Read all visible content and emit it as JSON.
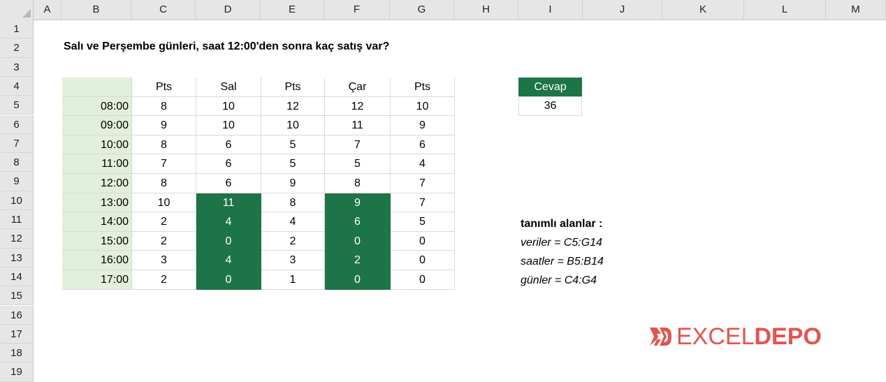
{
  "columns": [
    "A",
    "B",
    "C",
    "D",
    "E",
    "F",
    "G",
    "H",
    "I",
    "J",
    "K",
    "L",
    "M"
  ],
  "rows": [
    "1",
    "2",
    "3",
    "4",
    "5",
    "6",
    "7",
    "8",
    "9",
    "10",
    "11",
    "12",
    "13",
    "14",
    "15",
    "16",
    "17",
    "18",
    "19"
  ],
  "title": "Salı ve Perşembe günleri, saat 12:00'den sonra kaç satış var?",
  "table": {
    "headers": [
      "Pts",
      "Sal",
      "Pts",
      "Çar",
      "Pts"
    ],
    "rows": [
      {
        "time": "08:00",
        "values": [
          "8",
          "10",
          "12",
          "12",
          "10"
        ]
      },
      {
        "time": "09:00",
        "values": [
          "9",
          "10",
          "10",
          "11",
          "9"
        ]
      },
      {
        "time": "10:00",
        "values": [
          "8",
          "6",
          "5",
          "7",
          "6"
        ]
      },
      {
        "time": "11:00",
        "values": [
          "7",
          "6",
          "5",
          "5",
          "4"
        ]
      },
      {
        "time": "12:00",
        "values": [
          "8",
          "6",
          "9",
          "8",
          "7"
        ]
      },
      {
        "time": "13:00",
        "values": [
          "10",
          "11",
          "8",
          "9",
          "7"
        ]
      },
      {
        "time": "14:00",
        "values": [
          "2",
          "4",
          "4",
          "6",
          "5"
        ]
      },
      {
        "time": "15:00",
        "values": [
          "2",
          "0",
          "2",
          "0",
          "0"
        ]
      },
      {
        "time": "16:00",
        "values": [
          "3",
          "4",
          "3",
          "2",
          "0"
        ]
      },
      {
        "time": "17:00",
        "values": [
          "2",
          "0",
          "1",
          "0",
          "0"
        ]
      }
    ]
  },
  "answer": {
    "label": "Cevap",
    "value": "36"
  },
  "named_ranges": {
    "heading": "tanımlı alanlar :",
    "items": [
      "veriler = C5:G14",
      "saatler = B5:B14",
      "günler = C4:G4"
    ]
  },
  "logo": {
    "part1": "EXCEL",
    "part2": "DEPO"
  },
  "colors": {
    "accent": "#1d7447",
    "time_bg": "#e2efda",
    "logo": "#e2554f"
  }
}
